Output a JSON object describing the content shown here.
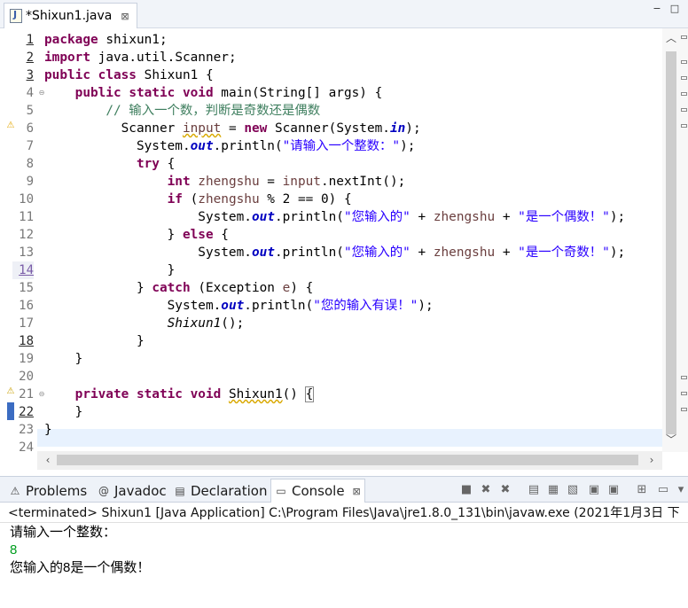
{
  "editor_tab": {
    "title": "*Shixun1.java",
    "close_glyph": "⊠"
  },
  "window_controls": {
    "minimize": "−",
    "maximize": "□"
  },
  "line_numbers": [
    "1",
    "2",
    "3",
    "4",
    "5",
    "6",
    "7",
    "8",
    "9",
    "10",
    "11",
    "12",
    "13",
    "14",
    "15",
    "16",
    "17",
    "18",
    "19",
    "20",
    "21",
    "22",
    "23",
    "24"
  ],
  "code_lines": [
    "package shixun1;",
    "import java.util.Scanner;",
    "public class Shixun1 {",
    "    public static void main(String[] args) {",
    "        // 输入一个数，判断是奇数还是偶数",
    "          Scanner input = new Scanner(System.in);",
    "            System.out.println(\"请输入一个整数：\");",
    "            try {",
    "                int zhengshu = input.nextInt();",
    "                if (zhengshu % 2 == 0) {",
    "                    System.out.println(\"您输入的\" + zhengshu + \"是一个偶数！\");",
    "                } else {",
    "                    System.out.println(\"您输入的\" + zhengshu + \"是一个奇数！\");",
    "                }",
    "            } catch (Exception e) {",
    "                System.out.println(\"您的输入有误！\");",
    "                Shixun1();",
    "            }",
    "    }",
    "",
    "    private static void Shixun1() {",
    "    }",
    "}",
    ""
  ],
  "panel_tabs": [
    {
      "label": "Problems",
      "icon": "problems-icon"
    },
    {
      "label": "Javadoc",
      "icon": "javadoc-icon"
    },
    {
      "label": "Declaration",
      "icon": "declaration-icon"
    },
    {
      "label": "Console",
      "icon": "console-icon",
      "active": true
    }
  ],
  "console": {
    "header": "<terminated> Shixun1 [Java Application] C:\\Program Files\\Java\\jre1.8.0_131\\bin\\javaw.exe (2021年1月3日 下",
    "output": [
      {
        "text": "请输入一个整数：",
        "kind": "stdout"
      },
      {
        "text": "8",
        "kind": "stdin"
      },
      {
        "text": "您输入的8是一个偶数！",
        "kind": "stdout"
      }
    ]
  },
  "colors": {
    "keyword": "#7f0055",
    "string": "#2a00ff",
    "comment": "#3f7f5f",
    "static_field": "#0000c0",
    "local_variable": "#6a3e3e",
    "console_input": "#009e1f",
    "current_line": "#e8f2fe"
  }
}
